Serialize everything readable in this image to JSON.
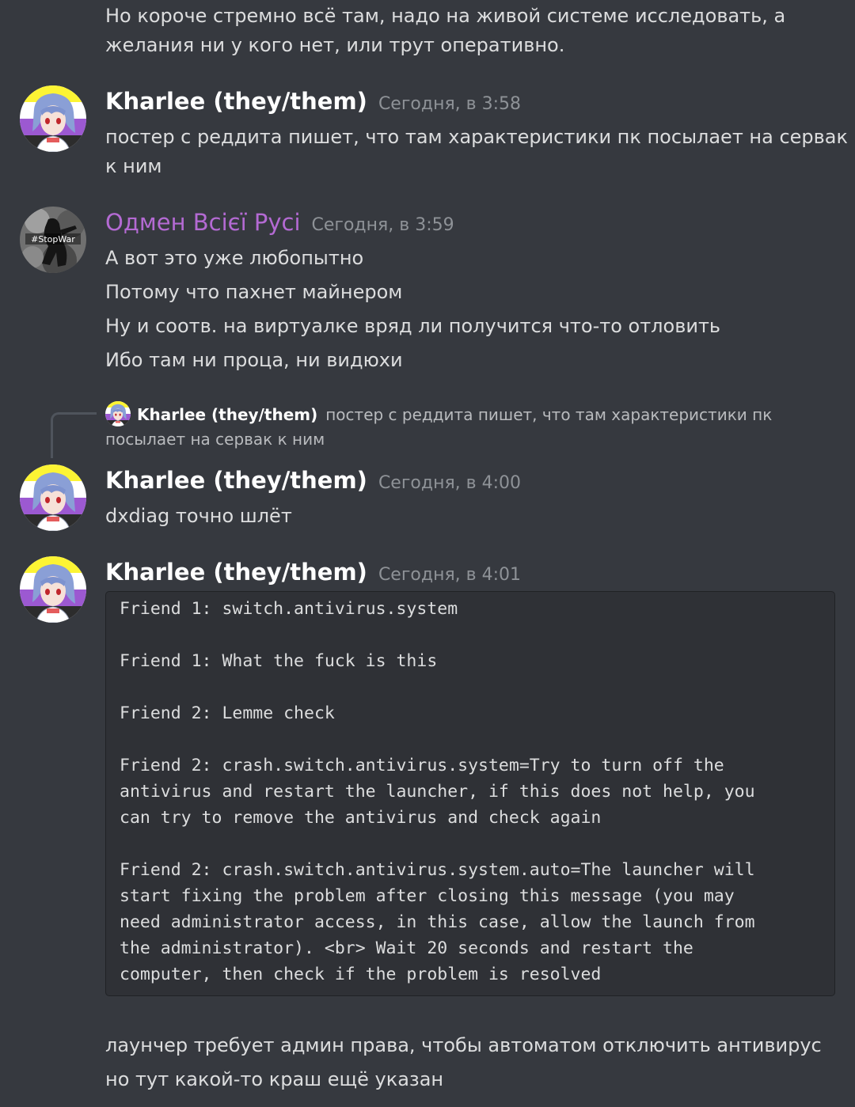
{
  "top_message": {
    "lines": [
      "Но короче стремно всё там, надо на живой системе исследовать, а",
      "желания ни у кого нет, или трут оперативно."
    ]
  },
  "messages": [
    {
      "author": "Kharlee (they/them)",
      "timestamp": "Сегодня, в 3:58",
      "lines": [
        "постер с реддита пишет, что там характеристики пк посылает на сервак",
        "к ним"
      ]
    },
    {
      "author": "Одмен Всієї Русі",
      "timestamp": "Сегодня, в 3:59",
      "avatar_text": "#StopWar",
      "lines": [
        "А вот это уже любопытно",
        "Потому что пахнет майнером",
        "Ну и соотв. на виртуалке вряд ли получится что-то отловить",
        "Ибо там ни проца, ни видюхи"
      ]
    },
    {
      "author": "Kharlee (they/them)",
      "timestamp": "Сегодня, в 4:00",
      "reply": {
        "author": "Kharlee (they/them)",
        "lines": [
          "постер с реддита пишет, что там характеристики пк",
          "посылает на сервак к ним"
        ]
      },
      "lines": [
        "dxdiag точно шлёт"
      ]
    },
    {
      "author": "Kharlee (they/them)",
      "timestamp": "Сегодня, в 4:01",
      "code_lines": [
        "Friend 1: switch.antivirus.system",
        "",
        "Friend 1: What the fuck is this",
        "",
        "Friend 2: Lemme check",
        "",
        "Friend 2: crash.switch.antivirus.system=Try to turn off the",
        "antivirus and restart the launcher, if this does not help, you",
        "can try to remove the antivirus and check again",
        "",
        "Friend 2: crash.switch.antivirus.system.auto=The launcher will",
        "start fixing the problem after closing this message (you may",
        "need administrator access, in this case, allow the launch from",
        "the administrator). <br> Wait 20 seconds and restart the",
        "computer, then check if the problem is resolved"
      ],
      "lines": [
        "лаунчер требует админ права, чтобы автоматом отключить антивирус",
        "но тут какой-то краш ещё указан"
      ]
    }
  ],
  "colors": {
    "background": "#36393f",
    "text": "#dcddde",
    "author": "#ffffff",
    "author_role": "#b46ad3",
    "timestamp": "#8e9297",
    "code_bg": "#2f3136"
  }
}
